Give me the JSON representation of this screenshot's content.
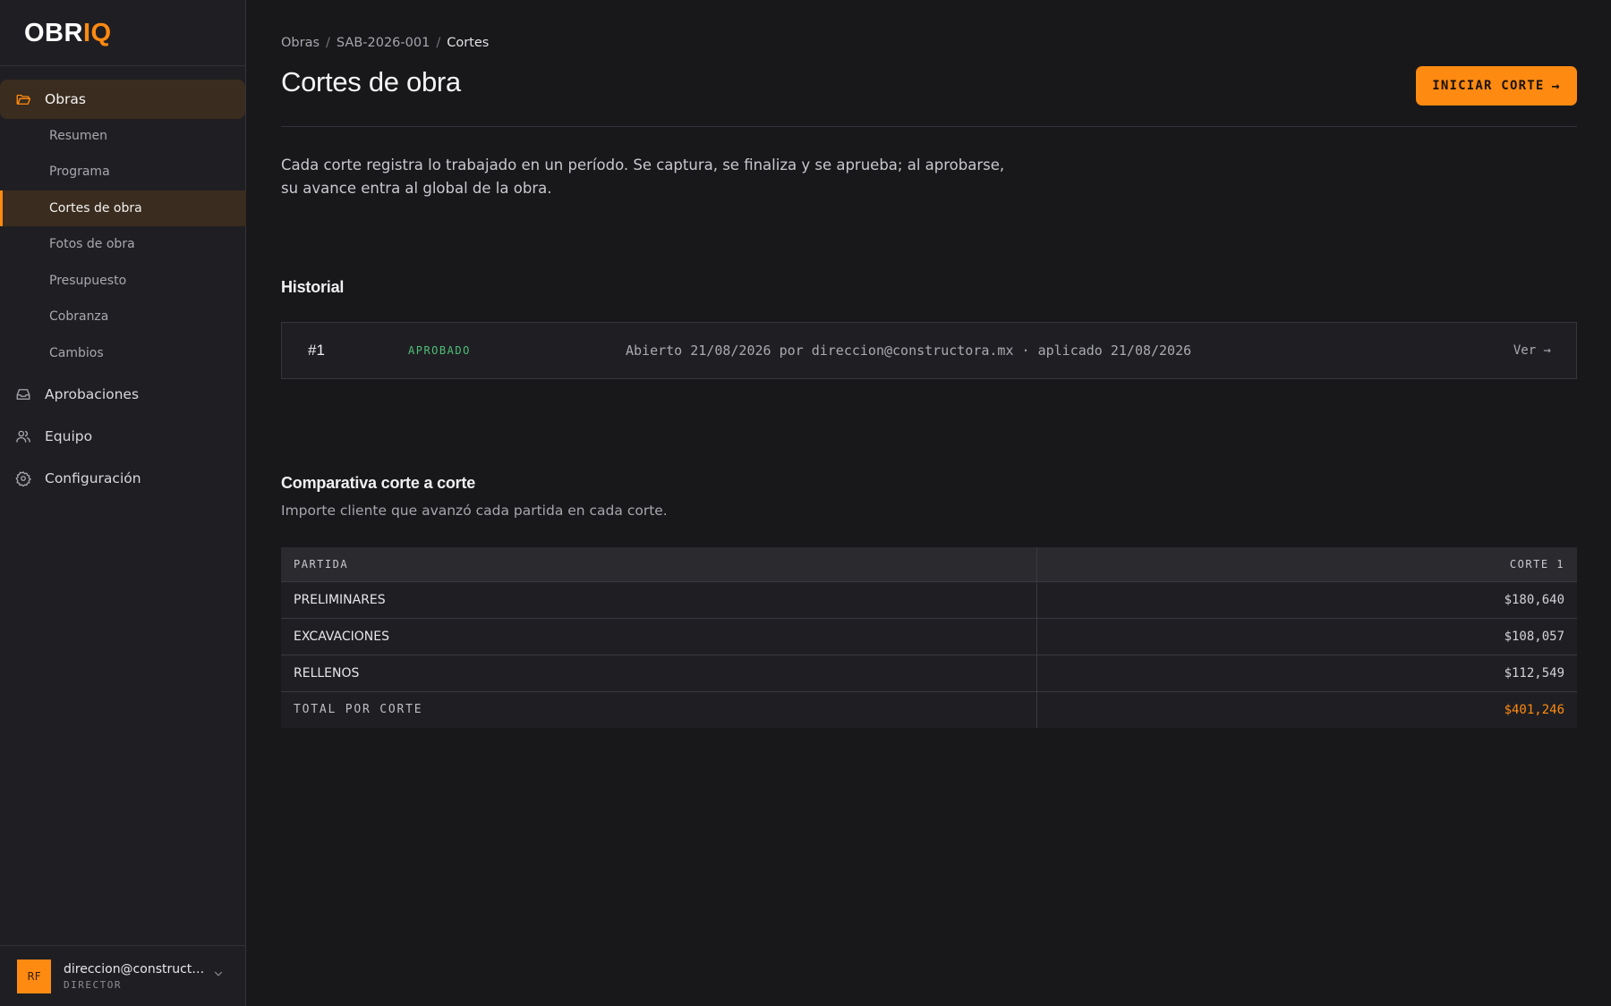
{
  "app": {
    "logo_main": "OBR",
    "logo_accent": "IQ"
  },
  "colors": {
    "accent": "#ff8a12",
    "status_approved": "#4fbf78",
    "background": "#18181b",
    "sidebar": "#1f1f23"
  },
  "sidebar": {
    "items": [
      {
        "label": "Obras",
        "icon": "folder-icon",
        "active": true
      },
      {
        "label": "Aprobaciones",
        "icon": "inbox-icon"
      },
      {
        "label": "Equipo",
        "icon": "users-icon"
      },
      {
        "label": "Configuración",
        "icon": "gear-icon"
      }
    ],
    "subitems": [
      "Resumen",
      "Programa",
      "Cortes de obra",
      "Fotos de obra",
      "Presupuesto",
      "Cobranza",
      "Cambios"
    ],
    "active_subitem": "Cortes de obra"
  },
  "user": {
    "initials": "RF",
    "email": "direccion@constructo...",
    "role": "DIRECTOR"
  },
  "breadcrumb": [
    "Obras",
    "SAB-2026-001",
    "Cortes"
  ],
  "page": {
    "title": "Cortes de obra",
    "cta_label": "INICIAR CORTE",
    "cta_arrow": "→",
    "intro": "Cada corte registra lo trabajado en un período. Se captura, se finaliza y se aprueba; al aprobarse, su avance entra al global de la obra."
  },
  "historial": {
    "title": "Historial",
    "rows": [
      {
        "number": "#1",
        "status": "APROBADO",
        "description": "Abierto 21/08/2026 por direccion@constructora.mx · aplicado 21/08/2026",
        "link": "Ver →"
      }
    ]
  },
  "comparativa": {
    "title": "Comparativa corte a corte",
    "subtitle": "Importe cliente que avanzó cada partida en cada corte.",
    "columns": [
      "PARTIDA",
      "CORTE 1"
    ],
    "rows": [
      {
        "partida": "PRELIMINARES",
        "corte1": "$180,640"
      },
      {
        "partida": "EXCAVACIONES",
        "corte1": "$108,057"
      },
      {
        "partida": "RELLENOS",
        "corte1": "$112,549"
      }
    ],
    "total_label": "TOTAL POR CORTE",
    "total_value": "$401,246"
  }
}
